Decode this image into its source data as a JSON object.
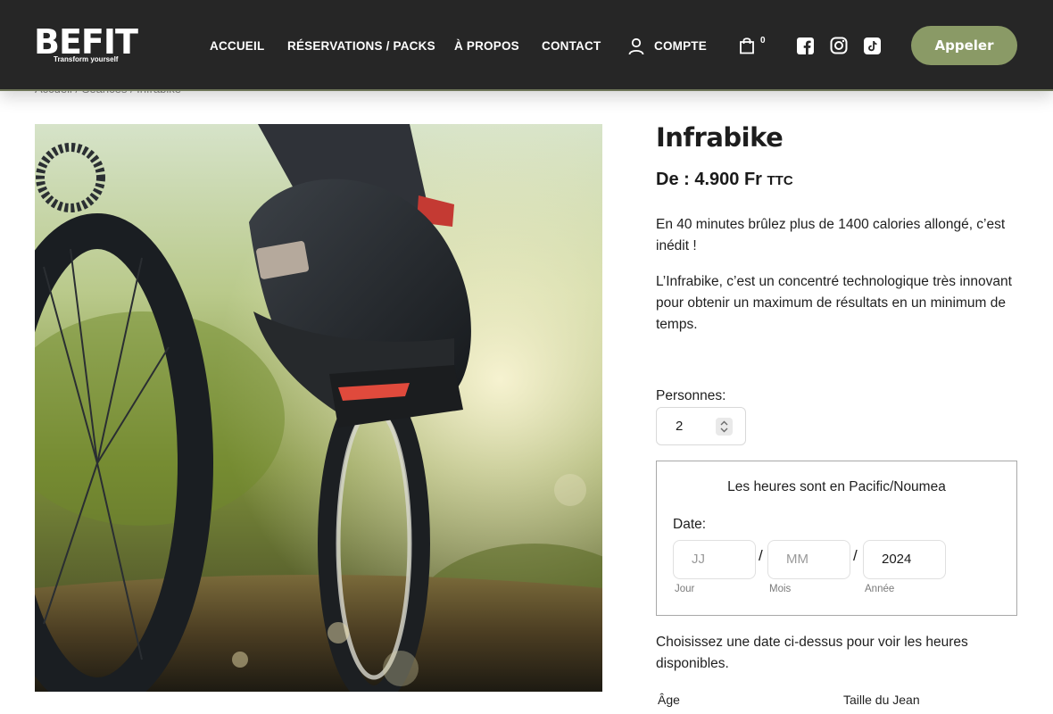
{
  "header": {
    "logo_text": "BEFIT",
    "logo_tagline": "Transform yourself",
    "nav": [
      "ACCUEIL",
      "RÉSERVATIONS / PACKS",
      "À PROPOS",
      "CONTACT"
    ],
    "account_label": "COMPTE",
    "cart_count": "0",
    "social_icons": [
      "facebook-icon",
      "instagram-icon",
      "tiktok-icon"
    ],
    "call_button": "Appeler",
    "colors": {
      "background": "#262626",
      "accent": "#8a9a66"
    }
  },
  "breadcrumb": "Accueil / Séances / Infrabike",
  "product": {
    "title": "Infrabike",
    "price_prefix": "De : 4.900 Fr",
    "price_suffix": "TTC",
    "description": [
      "En 40 minutes brûlez plus de 1400 calories allongé, c’est inédit !",
      "L’Infrabike, c’est un concentré technologique très innovant pour obtenir un maximum de résultats en un minimum de temps."
    ]
  },
  "booking": {
    "persons_label": "Personnes:",
    "persons_value": "2",
    "timezone_note": "Les heures sont en Pacific/Noumea",
    "date_label": "Date:",
    "day_placeholder": "JJ",
    "month_placeholder": "MM",
    "year_value": "2024",
    "separator": "/",
    "day_sublabel": "Jour",
    "month_sublabel": "Mois",
    "year_sublabel": "Année",
    "hint": "Choisissez une date ci-dessus pour voir les heures disponibles.",
    "age_label": "Âge",
    "size_label": "Taille du Jean"
  }
}
